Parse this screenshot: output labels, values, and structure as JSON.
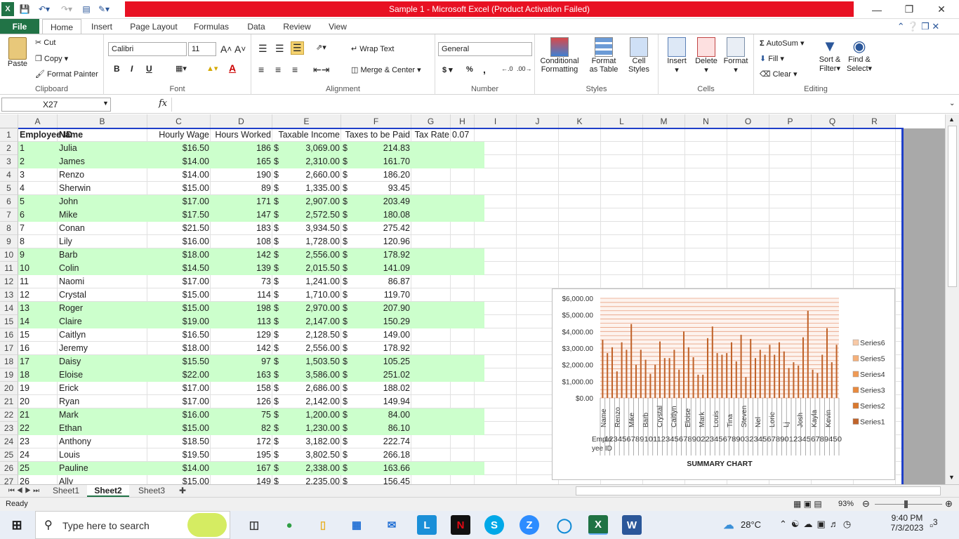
{
  "window": {
    "title": "Sample 1  -  Microsoft Excel (Product Activation Failed)"
  },
  "ribbon_tabs": [
    "File",
    "Home",
    "Insert",
    "Page Layout",
    "Formulas",
    "Data",
    "Review",
    "View"
  ],
  "clipboard": {
    "paste": "Paste",
    "cut": "Cut",
    "copy": "Copy",
    "format_painter": "Format Painter",
    "label": "Clipboard"
  },
  "font": {
    "name": "Calibri",
    "size": "11",
    "label": "Font",
    "bold": "B",
    "italic": "I",
    "underline": "U"
  },
  "alignment": {
    "wrap": "Wrap Text",
    "merge": "Merge & Center",
    "label": "Alignment"
  },
  "number": {
    "format": "General",
    "currency": "$",
    "percent": "%",
    "comma": ",",
    "label": "Number"
  },
  "styles": {
    "conditional": "Conditional",
    "conditional2": "Formatting",
    "format_table": "Format",
    "format_table2": "as Table",
    "cell_styles": "Cell",
    "cell_styles2": "Styles",
    "label": "Styles"
  },
  "cells": {
    "insert": "Insert",
    "delete": "Delete",
    "format": "Format",
    "label": "Cells"
  },
  "editing": {
    "autosum": "AutoSum",
    "fill": "Fill",
    "clear": "Clear",
    "sort": "Sort &",
    "sort2": "Filter",
    "find": "Find &",
    "find2": "Select",
    "label": "Editing"
  },
  "formula_bar": {
    "name_box": "X27",
    "fx": "fx",
    "value": ""
  },
  "columns": [
    "A",
    "B",
    "C",
    "D",
    "E",
    "F",
    "G",
    "H",
    "I",
    "J",
    "K",
    "L",
    "M",
    "N",
    "O",
    "P",
    "Q",
    "R"
  ],
  "headers": {
    "id": "Employee ID",
    "name": "Name",
    "wage": "Hourly Wage",
    "hours": "Hours Worked",
    "income": "Taxable Income",
    "taxes": "Taxes to be Paid",
    "rate_label": "Tax Rate",
    "rate": "0.07"
  },
  "rows": [
    {
      "id": "1",
      "name": "Julia",
      "wage": "$16.50",
      "hours": "186",
      "income": "3,069.00",
      "tax": "214.83"
    },
    {
      "id": "2",
      "name": "James",
      "wage": "$14.00",
      "hours": "165",
      "income": "2,310.00",
      "tax": "161.70"
    },
    {
      "id": "3",
      "name": "Renzo",
      "wage": "$14.00",
      "hours": "190",
      "income": "2,660.00",
      "tax": "186.20"
    },
    {
      "id": "4",
      "name": "Sherwin",
      "wage": "$15.00",
      "hours": "89",
      "income": "1,335.00",
      "tax": "93.45"
    },
    {
      "id": "5",
      "name": "John",
      "wage": "$17.00",
      "hours": "171",
      "income": "2,907.00",
      "tax": "203.49"
    },
    {
      "id": "6",
      "name": "Mike",
      "wage": "$17.50",
      "hours": "147",
      "income": "2,572.50",
      "tax": "180.08"
    },
    {
      "id": "7",
      "name": "Conan",
      "wage": "$21.50",
      "hours": "183",
      "income": "3,934.50",
      "tax": "275.42"
    },
    {
      "id": "8",
      "name": "Lily",
      "wage": "$16.00",
      "hours": "108",
      "income": "1,728.00",
      "tax": "120.96"
    },
    {
      "id": "9",
      "name": "Barb",
      "wage": "$18.00",
      "hours": "142",
      "income": "2,556.00",
      "tax": "178.92"
    },
    {
      "id": "10",
      "name": "Colin",
      "wage": "$14.50",
      "hours": "139",
      "income": "2,015.50",
      "tax": "141.09"
    },
    {
      "id": "11",
      "name": "Naomi",
      "wage": "$17.00",
      "hours": "73",
      "income": "1,241.00",
      "tax": "86.87"
    },
    {
      "id": "12",
      "name": "Crystal",
      "wage": "$15.00",
      "hours": "114",
      "income": "1,710.00",
      "tax": "119.70"
    },
    {
      "id": "13",
      "name": "Roger",
      "wage": "$15.00",
      "hours": "198",
      "income": "2,970.00",
      "tax": "207.90"
    },
    {
      "id": "14",
      "name": "Claire",
      "wage": "$19.00",
      "hours": "113",
      "income": "2,147.00",
      "tax": "150.29"
    },
    {
      "id": "15",
      "name": "Caitlyn",
      "wage": "$16.50",
      "hours": "129",
      "income": "2,128.50",
      "tax": "149.00"
    },
    {
      "id": "16",
      "name": "Jeremy",
      "wage": "$18.00",
      "hours": "142",
      "income": "2,556.00",
      "tax": "178.92"
    },
    {
      "id": "17",
      "name": "Daisy",
      "wage": "$15.50",
      "hours": "97",
      "income": "1,503.50",
      "tax": "105.25"
    },
    {
      "id": "18",
      "name": "Eloise",
      "wage": "$22.00",
      "hours": "163",
      "income": "3,586.00",
      "tax": "251.02"
    },
    {
      "id": "19",
      "name": "Erick",
      "wage": "$17.00",
      "hours": "158",
      "income": "2,686.00",
      "tax": "188.02"
    },
    {
      "id": "20",
      "name": "Ryan",
      "wage": "$17.00",
      "hours": "126",
      "income": "2,142.00",
      "tax": "149.94"
    },
    {
      "id": "21",
      "name": "Mark",
      "wage": "$16.00",
      "hours": "75",
      "income": "1,200.00",
      "tax": "84.00"
    },
    {
      "id": "22",
      "name": "Ethan",
      "wage": "$15.00",
      "hours": "82",
      "income": "1,230.00",
      "tax": "86.10"
    },
    {
      "id": "23",
      "name": "Anthony",
      "wage": "$18.50",
      "hours": "172",
      "income": "3,182.00",
      "tax": "222.74"
    },
    {
      "id": "24",
      "name": "Louis",
      "wage": "$19.50",
      "hours": "195",
      "income": "3,802.50",
      "tax": "266.18"
    },
    {
      "id": "25",
      "name": "Pauline",
      "wage": "$14.00",
      "hours": "167",
      "income": "2,338.00",
      "tax": "163.66"
    },
    {
      "id": "26",
      "name": "Ally",
      "wage": "$15.00",
      "hours": "149",
      "income": "2,235.00",
      "tax": "156.45"
    }
  ],
  "green_rows": [
    1,
    2,
    5,
    6,
    9,
    10,
    13,
    14,
    17,
    18,
    21,
    22,
    25
  ],
  "currency_symbol": "$",
  "chart_data": {
    "type": "bar",
    "title": "SUMMARY  CHART",
    "yticks": [
      "$6,000.00",
      "$5,000.00",
      "$4,000.00",
      "$3,000.00",
      "$2,000.00",
      "$1,000.00",
      "$0.00"
    ],
    "ylim": [
      0,
      6000
    ],
    "legend": [
      "Series6",
      "Series5",
      "Series4",
      "Series3",
      "Series2",
      "Series1"
    ],
    "legend_colors": [
      "#f8c9a6",
      "#f5b07a",
      "#f09a55",
      "#e88a3e",
      "#d9782d",
      "#c0632a"
    ],
    "category_labels": [
      "Name",
      "Renzo",
      "Mike",
      "Barb",
      "Crystal",
      "Caitlyn",
      "Eloise",
      "Mark",
      "Louis",
      "Tina",
      "Steven",
      "Nel",
      "Lorie",
      "Lj",
      "Josh",
      "Kayla",
      "Kevin"
    ],
    "x_axis_label_line1": "Emplo",
    "x_axis_label_line2": "yee ID",
    "x_numbers": "123456789101123456789022345678903234567890123456789450",
    "values": [
      3500,
      2700,
      3050,
      1600,
      3350,
      2900,
      4450,
      2000,
      2900,
      2300,
      1450,
      2000,
      3400,
      2400,
      2400,
      2900,
      1700,
      4000,
      3050,
      2450,
      1400,
      1400,
      3600,
      4300,
      2700,
      2600,
      2700,
      3350,
      2200,
      3800,
      1250,
      3550,
      2400,
      2900,
      2600,
      3200,
      2600,
      3350,
      2800,
      1800,
      2150,
      1950,
      3650,
      5250,
      1700,
      1500,
      2600,
      4200,
      2150,
      3200
    ],
    "bar_color": "#c0632a",
    "plot_bg_line_color": "#e8a080"
  },
  "sheets": [
    "Sheet1",
    "Sheet2",
    "Sheet3"
  ],
  "status": {
    "ready": "Ready",
    "zoom": "93%"
  },
  "taskbar": {
    "search": "Type here to search",
    "temp": "28°C",
    "time": "9:40 PM",
    "date": "7/3/2023",
    "notif": "3"
  }
}
